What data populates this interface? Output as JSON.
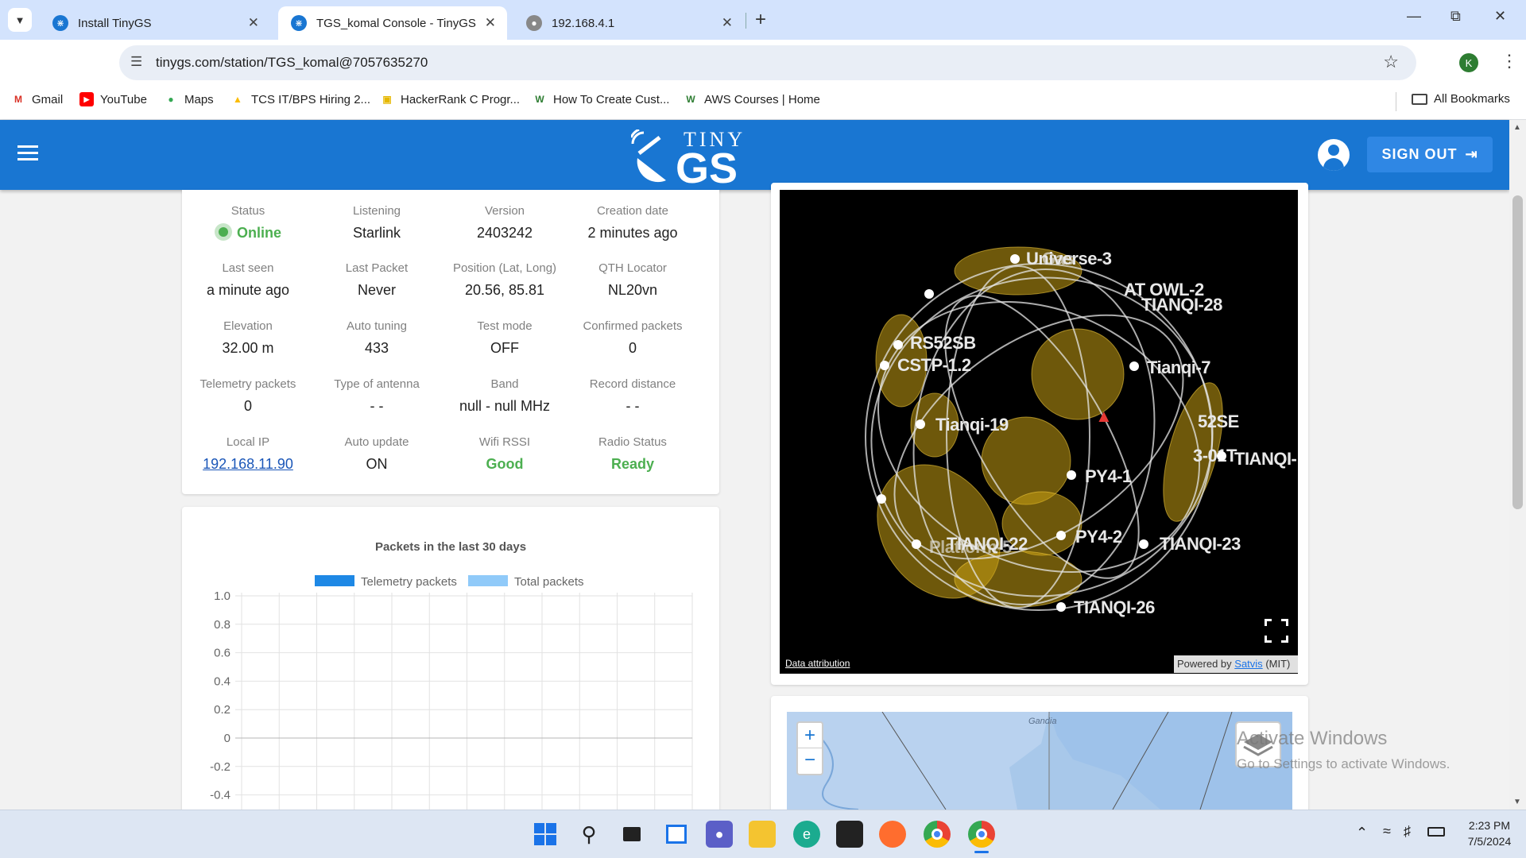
{
  "browser": {
    "tabs": [
      {
        "title": "Install TinyGS",
        "active": false
      },
      {
        "title": "TGS_komal Console - TinyGS",
        "active": true
      },
      {
        "title": "192.168.4.1",
        "active": false
      }
    ],
    "url": "tinygs.com/station/TGS_komal@7057635270",
    "profile_initial": "K",
    "bookmarks": [
      "Gmail",
      "YouTube",
      "Maps",
      "TCS IT/BPS Hiring 2...",
      "HackerRank C Progr...",
      "How To Create Cust...",
      "AWS Courses | Home"
    ],
    "all_bookmarks": "All Bookmarks"
  },
  "appbar": {
    "logo_top": "TINY",
    "logo_bottom": "GS",
    "signout_label": "SIGN OUT",
    "color": "#1976d2"
  },
  "station": {
    "fields": [
      {
        "label": "Status",
        "value": "Online",
        "style": "online"
      },
      {
        "label": "Listening",
        "value": "Starlink"
      },
      {
        "label": "Version",
        "value": "2403242"
      },
      {
        "label": "Creation date",
        "value": "2 minutes ago"
      },
      {
        "label": "Last seen",
        "value": "a minute ago"
      },
      {
        "label": "Last Packet",
        "value": "Never"
      },
      {
        "label": "Position (Lat, Long)",
        "value": "20.56, 85.81"
      },
      {
        "label": "QTH Locator",
        "value": "NL20vn"
      },
      {
        "label": "Elevation",
        "value": "32.00 m"
      },
      {
        "label": "Auto tuning",
        "value": "433"
      },
      {
        "label": "Test mode",
        "value": "OFF"
      },
      {
        "label": "Confirmed packets",
        "value": "0"
      },
      {
        "label": "Telemetry packets",
        "value": "0"
      },
      {
        "label": "Type of antenna",
        "value": "- -"
      },
      {
        "label": "Band",
        "value": "null - null MHz"
      },
      {
        "label": "Record distance",
        "value": "- -"
      },
      {
        "label": "Local IP",
        "value": "192.168.11.90",
        "style": "link"
      },
      {
        "label": "Auto update",
        "value": "ON"
      },
      {
        "label": "Wifi RSSI",
        "value": "Good",
        "style": "good"
      },
      {
        "label": "Radio Status",
        "value": "Ready",
        "style": "good"
      }
    ],
    "online_color": "#4caf50"
  },
  "chart_data": {
    "type": "bar",
    "title": "Packets in the last 30 days",
    "series": [
      {
        "name": "Telemetry packets",
        "color": "#1e88e5",
        "values": []
      },
      {
        "name": "Total packets",
        "color": "#90caf9",
        "values": []
      }
    ],
    "ylim": [
      -0.4,
      1.0
    ],
    "yticks": [
      "1.0",
      "0.8",
      "0.6",
      "0.4",
      "0.2",
      "0",
      "-0.2",
      "-0.4"
    ],
    "legend": "top"
  },
  "satmap": {
    "satellites": [
      "Universe-3",
      "AT OWL-2",
      "TIANQI-28",
      "RS52SB",
      "CSTP-1.2",
      "Tianqi-7",
      "Tianqi-19",
      "52SE",
      "3-01T",
      "TIANQI-",
      "PY4-1",
      "PY4-2",
      "TIANQI-22",
      "Platform-5",
      "TIANQI-23",
      "TIANQI-26"
    ],
    "attribution": "Data attribution",
    "powered_prefix": "Powered by",
    "powered_link": "Satvis",
    "powered_suffix": "(MIT)"
  },
  "map": {
    "zoom_in": "+",
    "zoom_out": "−",
    "place": "Gandia"
  },
  "watermark": {
    "line1": "Activate Windows",
    "line2": "Go to Settings to activate Windows."
  },
  "taskbar": {
    "time": "2:23 PM",
    "date": "7/5/2024"
  }
}
